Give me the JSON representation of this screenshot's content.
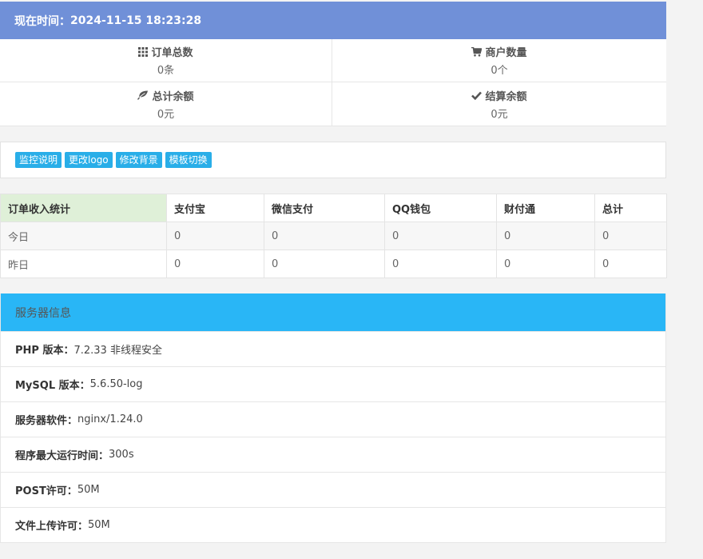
{
  "time": {
    "label": "现在时间：",
    "value": "2024-11-15 18:23:28"
  },
  "stats": [
    {
      "label": "订单总数",
      "value": "0条",
      "icon": "grid-icon"
    },
    {
      "label": "商户数量",
      "value": "0个",
      "icon": "cart-icon"
    },
    {
      "label": "总计余额",
      "value": "0元",
      "icon": "leaf-icon"
    },
    {
      "label": "结算余额",
      "value": "0元",
      "icon": "check-icon"
    }
  ],
  "buttons": {
    "monitor": "监控说明",
    "logo": "更改logo",
    "background": "修改背景",
    "template": "模板切换"
  },
  "income": {
    "headers": [
      "订单收入统计",
      "支付宝",
      "微信支付",
      "QQ钱包",
      "财付通",
      "总计"
    ],
    "rows": [
      [
        "今日",
        "0",
        "0",
        "0",
        "0",
        "0"
      ],
      [
        "昨日",
        "0",
        "0",
        "0",
        "0",
        "0"
      ]
    ]
  },
  "server": {
    "title": "服务器信息",
    "rows": [
      {
        "key": "PHP 版本：",
        "value": "7.2.33 非线程安全"
      },
      {
        "key": "MySQL 版本：",
        "value": "5.6.50-log"
      },
      {
        "key": "服务器软件：",
        "value": "nginx/1.24.0"
      },
      {
        "key": "程序最大运行时间：",
        "value": "300s"
      },
      {
        "key": "POST许可：",
        "value": "50M"
      },
      {
        "key": "文件上传许可：",
        "value": "50M"
      }
    ]
  },
  "colors": {
    "time_bar": "#7090d8",
    "button": "#29aee8",
    "server_head": "#29b6f6",
    "income_header": "#dff0d8"
  }
}
